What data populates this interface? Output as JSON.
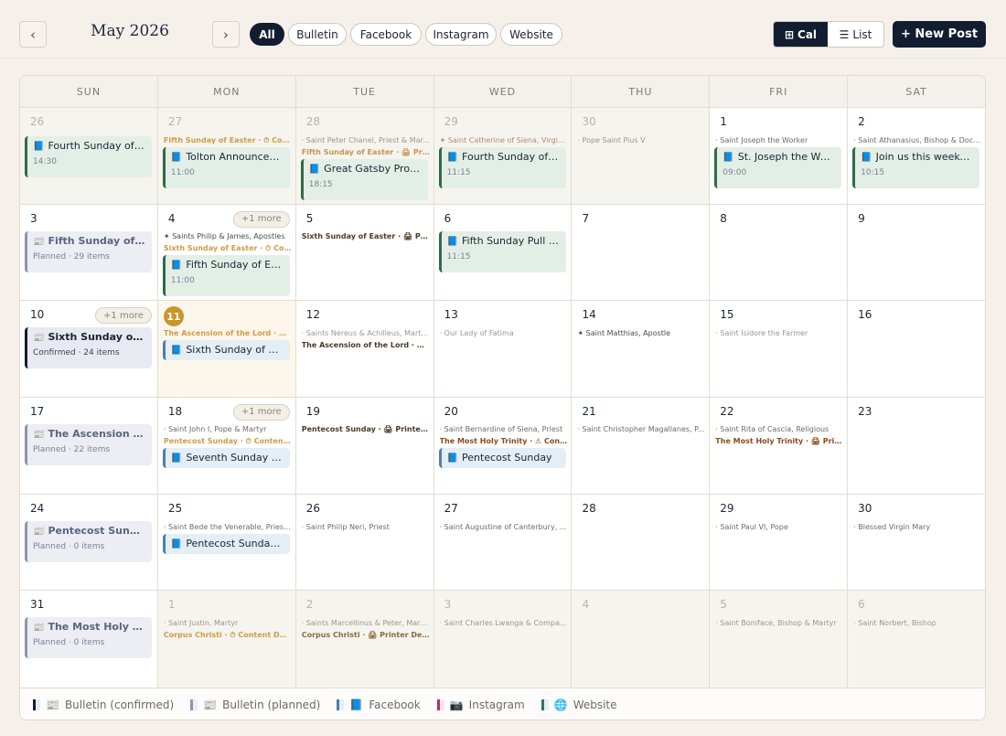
{
  "header": {
    "prev_label": "‹",
    "next_label": "›",
    "month_title": "May 2026",
    "filters": [
      {
        "label": "All",
        "active": true
      },
      {
        "label": "Bulletin",
        "active": false
      },
      {
        "label": "Facebook",
        "active": false
      },
      {
        "label": "Instagram",
        "active": false
      },
      {
        "label": "Website",
        "active": false
      }
    ],
    "view_cal_label": "Cal",
    "view_list_label": "List",
    "view_cal_icon": "⊞",
    "view_list_icon": "☰",
    "new_post_label": "+ New Post"
  },
  "weekdays": [
    "SUN",
    "MON",
    "TUE",
    "WED",
    "THU",
    "FRI",
    "SAT"
  ],
  "days": {
    "r0c0": {
      "num": "26",
      "ev1_title": "Fourth Sunday of E...",
      "ev1_time": "14:30"
    },
    "r0c1": {
      "num": "27",
      "feast": "Fifth Sunday of Easter · ⏱ Cont...",
      "ev1_title": "Tolton Announcem...",
      "ev1_time": "11:00"
    },
    "r0c2": {
      "num": "28",
      "saint": "· Saint Peter Chanel, Priest & Mar...",
      "feast": "Fifth Sunday of Easter · 🖨 Print...",
      "ev1_title": "Great Gatsby Prom...",
      "ev1_time": "18:15"
    },
    "r0c3": {
      "num": "29",
      "saint": "✦ Saint Catherine of Siena, Virgi...",
      "ev1_title": "Fourth Sunday of E...",
      "ev1_time": "11:15"
    },
    "r0c4": {
      "num": "30",
      "saint": "· Pope Saint Pius V"
    },
    "r0c5": {
      "num": "1",
      "saint": "· Saint Joseph the Worker",
      "ev1_title": "St. Joseph the Wor...",
      "ev1_time": "09:00"
    },
    "r0c6": {
      "num": "2",
      "saint": "· Saint Athanasius, Bishop & Doc...",
      "ev1_title": "Join us this weeke...",
      "ev1_time": "10:15"
    },
    "r1c0": {
      "num": "3",
      "ev1_title": "Fifth Sunday of Ea...",
      "ev1_sub": "Planned · 29 items"
    },
    "r1c1": {
      "num": "4",
      "more": "+1 more",
      "saint": "✦ Saints Philip & James, Apostles",
      "feast": "Sixth Sunday of Easter · ⏱ Cont...",
      "ev1_title": "Fifth Sunday of Eas...",
      "ev1_time": "11:00"
    },
    "r1c2": {
      "num": "5",
      "feast": "Sixth Sunday of Easter · 🖨 Print..."
    },
    "r1c3": {
      "num": "6",
      "ev1_title": "Fifth Sunday Pull Q...",
      "ev1_time": "11:15"
    },
    "r1c4": {
      "num": "7"
    },
    "r1c5": {
      "num": "8"
    },
    "r1c6": {
      "num": "9"
    },
    "r2c0": {
      "num": "10",
      "more": "+1 more",
      "ev1_title": "Sixth Sunday of Ea...",
      "ev1_sub": "Confirmed · 24 items"
    },
    "r2c1": {
      "num": "11",
      "feast": "The Ascension of the Lord · ⏱ ...",
      "ev1_title": "Sixth Sunday of Ea..."
    },
    "r2c2": {
      "num": "12",
      "saint": "· Saints Nereus & Achilleus, Mart...",
      "feast": "The Ascension of the Lord · 🖨 P..."
    },
    "r2c3": {
      "num": "13",
      "saint": "· Our Lady of Fatima"
    },
    "r2c4": {
      "num": "14",
      "saint": "✦ Saint Matthias, Apostle"
    },
    "r2c5": {
      "num": "15",
      "saint": "· Saint Isidore the Farmer"
    },
    "r2c6": {
      "num": "16"
    },
    "r3c0": {
      "num": "17",
      "ev1_title": "The Ascension of t...",
      "ev1_sub": "Planned · 22 items"
    },
    "r3c1": {
      "num": "18",
      "more": "+1 more",
      "saint": "· Saint John I, Pope & Martyr",
      "feast": "Pentecost Sunday · ⏱ Content ...",
      "ev1_title": "Seventh Sunday of ..."
    },
    "r3c2": {
      "num": "19",
      "feast": "Pentecost Sunday · 🖨 Printer D..."
    },
    "r3c3": {
      "num": "20",
      "saint": "· Saint Bernardine of Siena, Priest",
      "feast": "The Most Holy Trinity · ⚠ Conte...",
      "ev1_title": "Pentecost Sunday"
    },
    "r3c4": {
      "num": "21",
      "saint": "· Saint Christopher Magallanes, P..."
    },
    "r3c5": {
      "num": "22",
      "saint": "· Saint Rita of Cascia, Religious",
      "feast": "The Most Holy Trinity · 🖨 Printe..."
    },
    "r3c6": {
      "num": "23"
    },
    "r4c0": {
      "num": "24",
      "ev1_title": "Pentecost Sunday",
      "ev1_sub": "Planned · 0 items"
    },
    "r4c1": {
      "num": "25",
      "saint": "· Saint Bede the Venerable, Pries...",
      "ev1_title": "Pentecost Sunday ..."
    },
    "r4c2": {
      "num": "26",
      "saint": "· Saint Philip Neri, Priest"
    },
    "r4c3": {
      "num": "27",
      "saint": "· Saint Augustine of Canterbury, ..."
    },
    "r4c4": {
      "num": "28"
    },
    "r4c5": {
      "num": "29",
      "saint": "· Saint Paul VI, Pope"
    },
    "r4c6": {
      "num": "30",
      "saint": "· Blessed Virgin Mary"
    },
    "r5c0": {
      "num": "31",
      "ev1_title": "The Most Holy Trin...",
      "ev1_sub": "Planned · 0 items"
    },
    "r5c1": {
      "num": "1",
      "saint": "· Saint Justin, Martyr",
      "feast": "Corpus Christi · ⏱ Content Due..."
    },
    "r5c2": {
      "num": "2",
      "saint": "· Saints Marcellinus & Peter, Mart...",
      "feast": "Corpus Christi · 🖨 Printer Dead..."
    },
    "r5c3": {
      "num": "3",
      "saint": "· Saint Charles Lwanga & Compa..."
    },
    "r5c4": {
      "num": "4"
    },
    "r5c5": {
      "num": "5",
      "saint": "· Saint Boniface, Bishop & Martyr"
    },
    "r5c6": {
      "num": "6",
      "saint": "· Saint Norbert, Bishop"
    }
  },
  "legend": [
    {
      "label": "Bulletin (confirmed)",
      "icon": "📰",
      "color": "#131d31"
    },
    {
      "label": "Bulletin (planned)",
      "icon": "📰",
      "color": "#8c95b0"
    },
    {
      "label": "Facebook",
      "icon": "📘",
      "color": "#4f7eaa"
    },
    {
      "label": "Instagram",
      "icon": "📷",
      "color": "#b0306a"
    },
    {
      "label": "Website",
      "icon": "🌐",
      "color": "#2f7a5a"
    }
  ],
  "colors": {
    "primary": "#131d31",
    "today": "#c8962b",
    "facebook_bar": "#2f6b45",
    "background": "#f5f1ea"
  }
}
